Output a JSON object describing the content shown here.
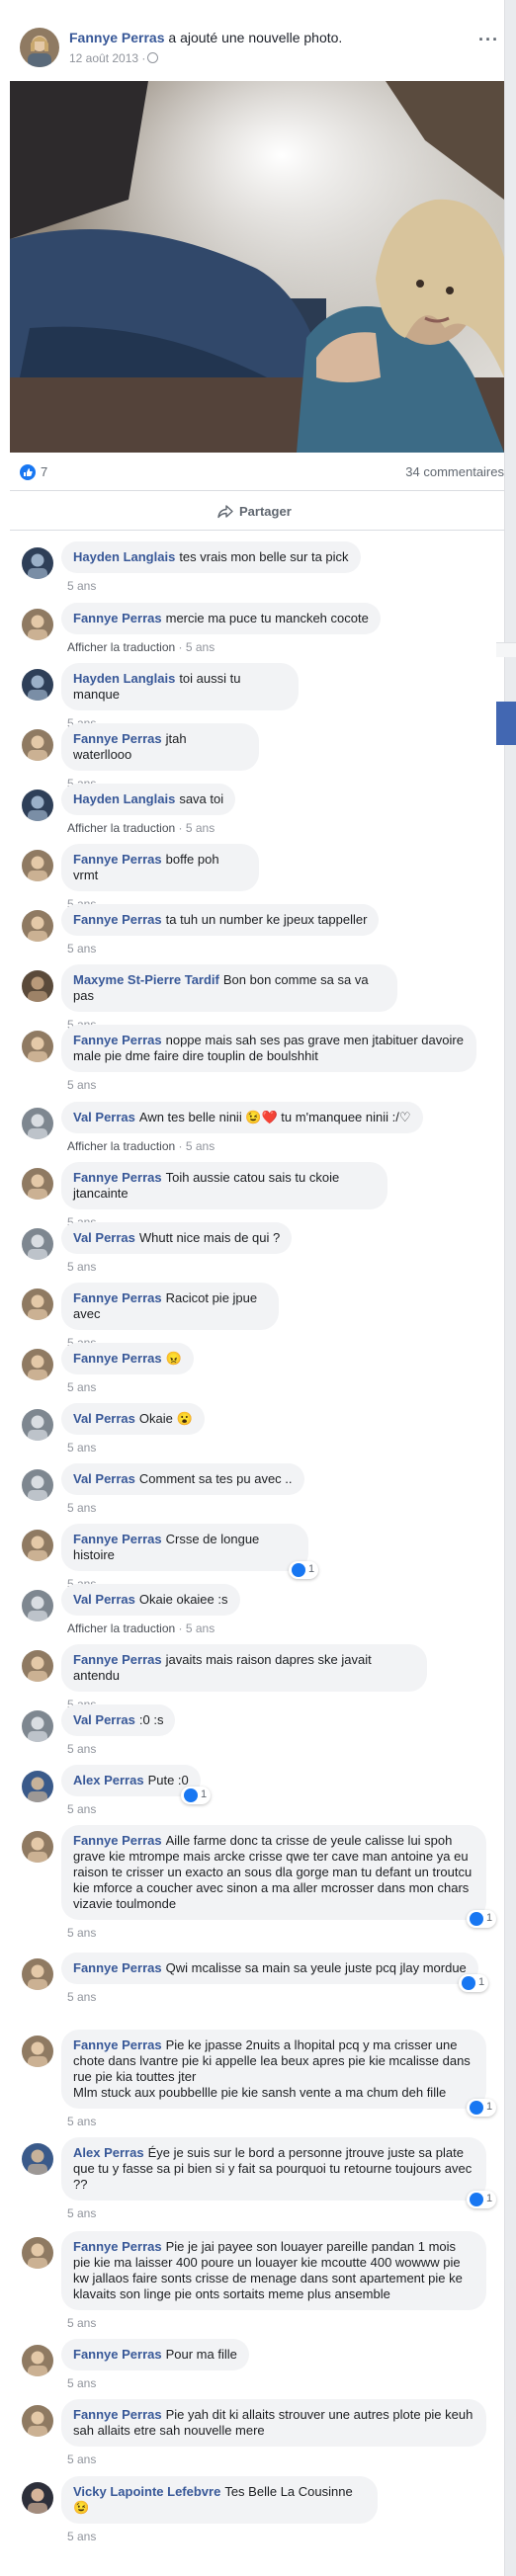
{
  "post": {
    "author": "Fannye Perras",
    "action": " a ajouté une nouvelle photo.",
    "date": "12 août 2013 ·",
    "more": "···"
  },
  "counts": {
    "likes": "7",
    "comments": "34 commentaires"
  },
  "share_label": "Partager",
  "colors": {
    "link": "#385898",
    "like": "#1877f2",
    "bubble": "#f2f3f5"
  },
  "comments": [
    {
      "author": "Hayden Langlais",
      "text": "tes vrais mon belle sur ta pick",
      "meta": "5 ans"
    },
    {
      "author": "Fannye Perras",
      "text": "mercie ma puce tu manckeh cocote",
      "translate": "Afficher la traduction",
      "meta": " · 5 ans"
    },
    {
      "author": "Hayden Langlais",
      "text": "toi aussi tu manque",
      "meta": "5 ans"
    },
    {
      "author": "Fannye Perras",
      "text": "jtah waterllooo",
      "meta": "5 ans"
    },
    {
      "author": "Hayden Langlais",
      "text": "sava toi",
      "translate": "Afficher la traduction",
      "meta": " · 5 ans"
    },
    {
      "author": "Fannye Perras",
      "text": "boffe poh vrmt",
      "meta": "5 ans"
    },
    {
      "author": "Fannye Perras",
      "text": "ta tuh un number ke jpeux tappeller",
      "meta": "5 ans"
    },
    {
      "author": "Maxyme St-Pierre Tardif",
      "text": "Bon bon comme sa sa va pas",
      "meta": "5 ans"
    },
    {
      "author": "Fannye Perras",
      "text": "noppe mais sah ses pas grave men jtabituer davoire male pie dme faire dire touplin de boulshhit",
      "meta": "5 ans"
    },
    {
      "author": "Val Perras",
      "text": "Awn tes belle ninii 😉❤️ tu m'manquee ninii :/♡",
      "translate": "Afficher la traduction",
      "meta": " · 5 ans"
    },
    {
      "author": "Fannye Perras",
      "text": "Toih aussie catou sais tu ckoie jtancainte",
      "meta": "5 ans"
    },
    {
      "author": "Val Perras",
      "text": "Whutt nice mais de qui ?",
      "meta": "5 ans"
    },
    {
      "author": "Fannye Perras",
      "text": "Racicot pie jpue avec",
      "meta": "5 ans"
    },
    {
      "author": "Fannye Perras",
      "text": "😠",
      "meta": "5 ans"
    },
    {
      "author": "Val Perras",
      "text": "Okaie 😮",
      "meta": "5 ans"
    },
    {
      "author": "Val Perras",
      "text": "Comment sa tes pu avec ..",
      "meta": "5 ans"
    },
    {
      "author": "Fannye Perras",
      "text": "Crsse de longue histoire",
      "meta": "5 ans",
      "reactions": "1"
    },
    {
      "author": "Val Perras",
      "text": "Okaie okaiee :s",
      "translate": "Afficher la traduction",
      "meta": " · 5 ans"
    },
    {
      "author": "Fannye Perras",
      "text": "javaits mais raison dapres ske javait antendu",
      "meta": "5 ans"
    },
    {
      "author": "Val Perras",
      "text": ":0 :s",
      "meta": "5 ans"
    },
    {
      "author": "Alex Perras",
      "text": "Pute :0",
      "meta": "5 ans",
      "reactions": "1"
    },
    {
      "author": "Fannye Perras",
      "text": "Aille farme donc ta crisse de yeule calisse lui spoh grave kie mtrompe mais arcke crisse qwe ter cave man antoine ya eu raison te crisser un exacto an sous dla gorge man tu defant un troutcu kie mforce a coucher avec sinon a ma aller mcrosser dans mon chars vizavie toulmonde",
      "meta": "5 ans",
      "reactions": "1"
    },
    {
      "author": "Fannye Perras",
      "text": "Qwi mcalisse sa main sa yeule juste pcq jlay mordue",
      "meta": "5 ans",
      "reactions": "1"
    },
    {
      "author": "Fannye Perras",
      "text": "Pie ke jpasse 2nuits a lhopital pcq y ma crisser une chote dans lvantre pie ki appelle lea beux apres pie kie mcalisse dans rue pie kia touttes jter\nMlm stuck aux poubbellle pie kie sansh vente a ma chum deh fille",
      "meta": "5 ans",
      "reactions": "1"
    },
    {
      "author": "Alex Perras",
      "text": "Éye je suis sur le bord a personne jtrouve juste sa plate\nque tu y fasse sa pi bien si y fait sa pourquoi tu retourne toujours avec ??",
      "meta": "5 ans",
      "reactions": "1"
    },
    {
      "author": "Fannye Perras",
      "text": "Pie je jai payee son louayer pareille pandan 1 mois pie kie ma laisser 400 poure un louayer kie mcoutte 400 wowww pie kw jallaos faire sonts crisse de menage dans sont apartement pie ke klavaits son linge pie onts sortaits meme plus ansemble",
      "meta": "5 ans"
    },
    {
      "author": "Fannye Perras",
      "text": "Pour ma fille",
      "meta": "5 ans"
    },
    {
      "author": "Fannye Perras",
      "text": "Pie yah dit ki allaits strouver une autres plote pie keuh sah allaits etre sah nouvelle mere",
      "meta": "5 ans"
    },
    {
      "author": "Vicky Lapointe Lefebvre",
      "text": "Tes Belle La Cousinne 😉",
      "meta": "5 ans"
    }
  ]
}
